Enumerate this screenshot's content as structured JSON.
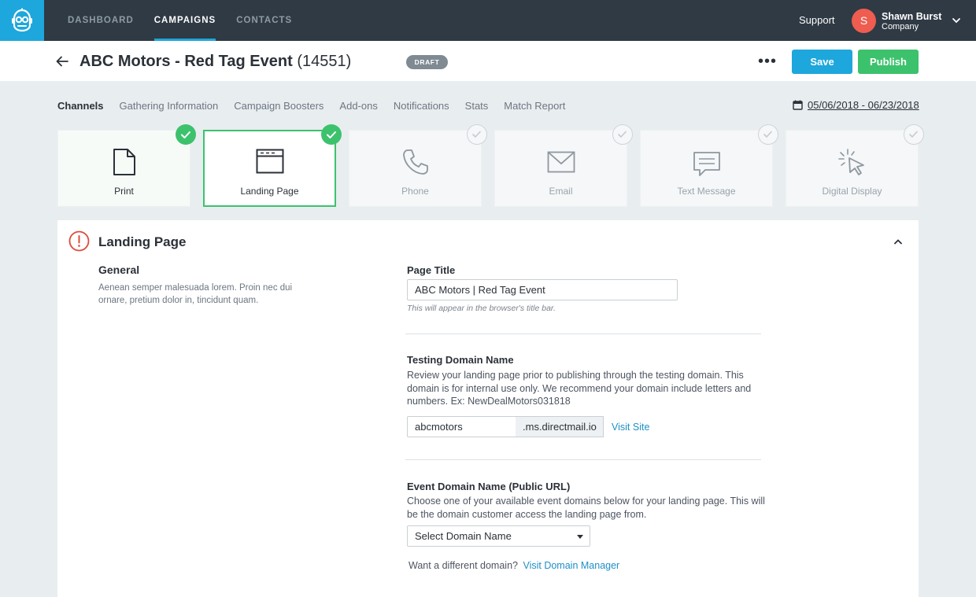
{
  "nav": {
    "links": [
      {
        "label": "DASHBOARD",
        "active": false
      },
      {
        "label": "CAMPAIGNS",
        "active": true
      },
      {
        "label": "CONTACTS",
        "active": false
      }
    ],
    "support_label": "Support",
    "user": {
      "initial": "S",
      "name": "Shawn Burst",
      "company": "Company"
    }
  },
  "header": {
    "title": "ABC Motors - Red Tag Event",
    "campaign_id": "(14551)",
    "status_badge": "DRAFT",
    "save_label": "Save",
    "publish_label": "Publish"
  },
  "tabs": [
    {
      "label": "Channels",
      "active": true
    },
    {
      "label": "Gathering Information",
      "active": false
    },
    {
      "label": "Campaign Boosters",
      "active": false
    },
    {
      "label": "Add-ons",
      "active": false
    },
    {
      "label": "Notifications",
      "active": false
    },
    {
      "label": "Stats",
      "active": false
    },
    {
      "label": "Match Report",
      "active": false
    }
  ],
  "date_range": "05/06/2018 - 06/23/2018",
  "channels": [
    {
      "label": "Print",
      "icon": "document-icon",
      "complete": true,
      "selected": false
    },
    {
      "label": "Landing Page",
      "icon": "browser-window-icon",
      "complete": true,
      "selected": true
    },
    {
      "label": "Phone",
      "icon": "phone-icon",
      "complete": false,
      "selected": false
    },
    {
      "label": "Email",
      "icon": "envelope-icon",
      "complete": false,
      "selected": false
    },
    {
      "label": "Text Message",
      "icon": "chat-bubble-icon",
      "complete": false,
      "selected": false
    },
    {
      "label": "Digital Display",
      "icon": "cursor-click-icon",
      "complete": false,
      "selected": false
    }
  ],
  "panel": {
    "title": "Landing Page",
    "general": {
      "heading": "General",
      "description": "Aenean semper malesuada lorem. Proin nec dui ornare, pretium dolor in, tincidunt quam."
    },
    "page_title": {
      "label": "Page Title",
      "value": "ABC Motors | Red Tag Event",
      "hint": "This will appear in the browser's title bar."
    },
    "testing_domain": {
      "label": "Testing Domain Name",
      "description": "Review your landing page prior to publishing through the testing domain. This domain is for internal use only.  We recommend your domain include letters and numbers. Ex: NewDealMotors031818",
      "value": "abcmotors",
      "suffix": ".ms.directmail.io",
      "visit_link": "Visit Site"
    },
    "event_domain": {
      "label": "Event Domain Name (Public URL)",
      "description": "Choose one of your available event domains below for your landing page. This will be the domain customer access the landing page from.",
      "select_value": "Select Domain Name",
      "want_text": "Want a different domain?",
      "manager_link": "Visit Domain Manager"
    }
  },
  "colors": {
    "nav_bg": "#2f3a44",
    "accent_blue": "#1ea7dc",
    "success_green": "#3cc26d",
    "avatar_red": "#ee5d50",
    "warning_red": "#e0483b"
  }
}
